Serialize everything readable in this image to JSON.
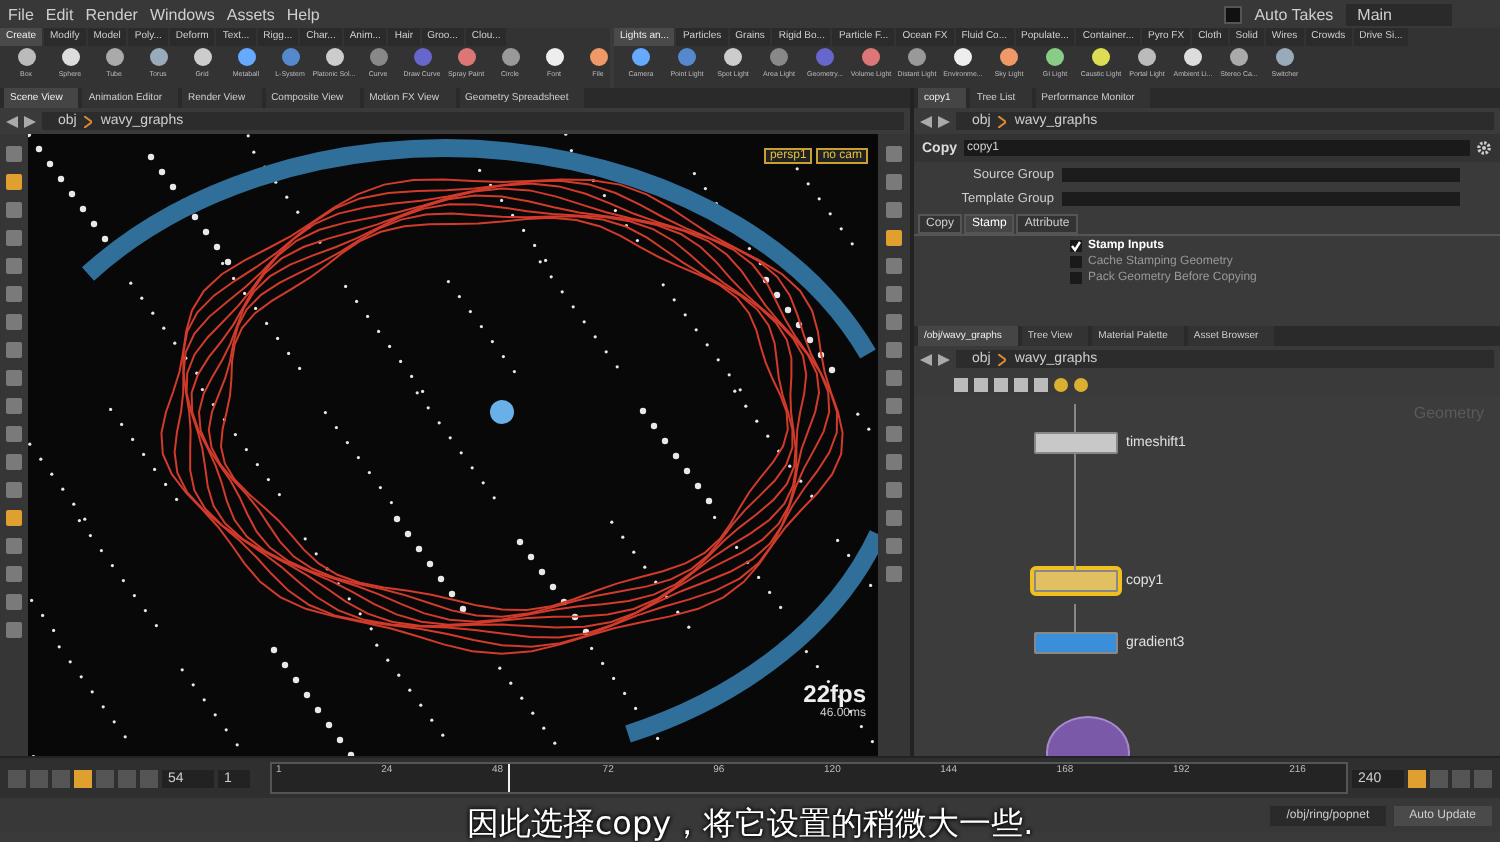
{
  "menu": [
    "File",
    "Edit",
    "Render",
    "Windows",
    "Assets",
    "Help"
  ],
  "auto_takes": {
    "label": "Auto Takes",
    "checked": false
  },
  "desktop": "Main",
  "shelf_tabs_left": [
    {
      "label": "Create",
      "selected": true
    },
    {
      "label": "Modify",
      "selected": false
    },
    {
      "label": "Model",
      "selected": false
    },
    {
      "label": "Poly...",
      "selected": false
    },
    {
      "label": "Deform",
      "selected": false
    },
    {
      "label": "Text...",
      "selected": false
    },
    {
      "label": "Rigg...",
      "selected": false
    },
    {
      "label": "Char...",
      "selected": false
    },
    {
      "label": "Anim...",
      "selected": false
    },
    {
      "label": "Hair",
      "selected": false
    },
    {
      "label": "Groo...",
      "selected": false
    },
    {
      "label": "Clou...",
      "selected": false
    }
  ],
  "shelf_tabs_right": [
    {
      "label": "Lights an...",
      "selected": true
    },
    {
      "label": "Particles",
      "selected": false
    },
    {
      "label": "Grains",
      "selected": false
    },
    {
      "label": "Rigid Bo...",
      "selected": false
    },
    {
      "label": "Particle F...",
      "selected": false
    },
    {
      "label": "Ocean FX",
      "selected": false
    },
    {
      "label": "Fluid Co...",
      "selected": false
    },
    {
      "label": "Populate...",
      "selected": false
    },
    {
      "label": "Container...",
      "selected": false
    },
    {
      "label": "Pyro FX",
      "selected": false
    },
    {
      "label": "Cloth",
      "selected": false
    },
    {
      "label": "Solid",
      "selected": false
    },
    {
      "label": "Wires",
      "selected": false
    },
    {
      "label": "Crowds",
      "selected": false
    },
    {
      "label": "Drive Si...",
      "selected": false
    }
  ],
  "shelf_tools_left": [
    "Box",
    "Sphere",
    "Tube",
    "Torus",
    "Grid",
    "Metaball",
    "L-System",
    "Platonic Sol...",
    "Curve",
    "Draw Curve",
    "Spray Paint",
    "Circle",
    "Font",
    "File"
  ],
  "shelf_tools_right": [
    "Camera",
    "Point Light",
    "Spot Light",
    "Area Light",
    "Geometry...",
    "Volume Light",
    "Distant Light",
    "Environme...",
    "Sky Light",
    "GI Light",
    "Caustic Light",
    "Portal Light",
    "Ambient Li...",
    "Stereo Ca...",
    "Switcher"
  ],
  "viewer_tabs": [
    {
      "label": "Scene View",
      "selected": true
    },
    {
      "label": "Animation Editor",
      "selected": false
    },
    {
      "label": "Render View",
      "selected": false
    },
    {
      "label": "Composite View",
      "selected": false
    },
    {
      "label": "Motion FX View",
      "selected": false
    },
    {
      "label": "Geometry Spreadsheet",
      "selected": false
    }
  ],
  "viewer_path": [
    "obj",
    "wavy_graphs"
  ],
  "viewport": {
    "camera": "persp1",
    "cam_menu": "no cam",
    "fps": "22fps",
    "time": "46.00ms"
  },
  "param_tabs": [
    {
      "label": "copy1",
      "selected": true
    },
    {
      "label": "Tree List",
      "selected": false
    },
    {
      "label": "Performance Monitor",
      "selected": false
    }
  ],
  "param_path": [
    "obj",
    "wavy_graphs"
  ],
  "node_header": {
    "type": "Copy",
    "name": "copy1"
  },
  "fields": [
    {
      "label": "Source Group"
    },
    {
      "label": "Template Group"
    }
  ],
  "param_subtabs": [
    {
      "label": "Copy",
      "selected": false
    },
    {
      "label": "Stamp",
      "selected": true
    },
    {
      "label": "Attribute",
      "selected": false
    }
  ],
  "toggles": [
    {
      "label": "Stamp Inputs",
      "checked": true
    },
    {
      "label": "Cache Stamping Geometry",
      "checked": false
    },
    {
      "label": "Pack Geometry Before Copying",
      "checked": false
    }
  ],
  "network_tabs": [
    {
      "label": "/obj/wavy_graphs",
      "selected": true
    },
    {
      "label": "Tree View",
      "selected": false
    },
    {
      "label": "Material Palette",
      "selected": false
    },
    {
      "label": "Asset Browser",
      "selected": false
    }
  ],
  "network_path": [
    "obj",
    "wavy_graphs"
  ],
  "network_label": "Geometry",
  "nodes": [
    {
      "name": "timeshift1",
      "color": "#c8c8c8",
      "selected": false
    },
    {
      "name": "copy1",
      "color": "#e0c060",
      "selected": true
    },
    {
      "name": "gradient3",
      "color": "#3a8fd8",
      "selected": false
    }
  ],
  "timeline": {
    "frame": "54",
    "step": "1",
    "ticks": [
      "1",
      "24",
      "48",
      "72",
      "96",
      "120",
      "144",
      "168",
      "192",
      "216"
    ],
    "end": "240",
    "playhead": {
      "level": 0.22
    }
  },
  "subtitle": "因此选择copy，将它设置的稍微大一些.",
  "status": {
    "path": "/obj/ring/popnet",
    "update": "Auto Update"
  }
}
